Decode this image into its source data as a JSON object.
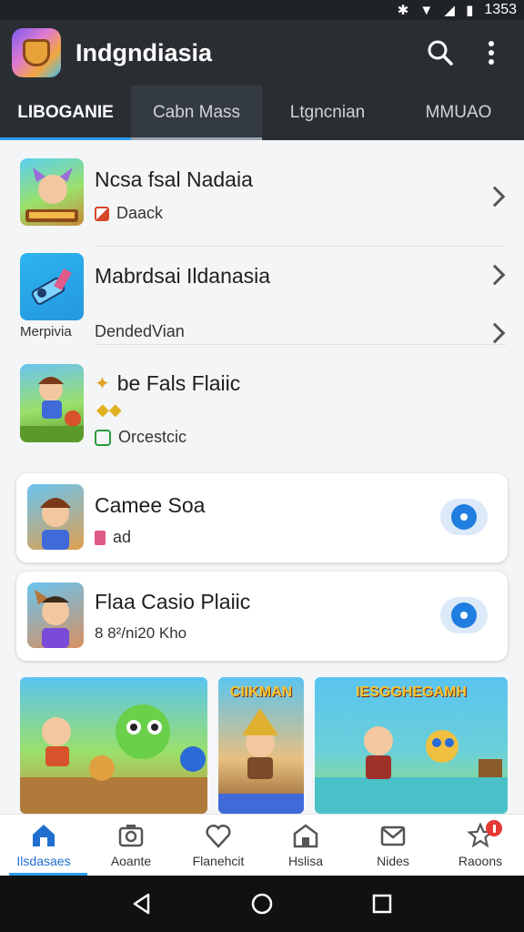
{
  "status_bar": {
    "time": "1353"
  },
  "app_bar": {
    "title": "Indgndiasia"
  },
  "tabs": [
    {
      "label": "LIBOGANIE"
    },
    {
      "label": "Cabn Mass"
    },
    {
      "label": "Ltgncnian"
    },
    {
      "label": "MMUAO"
    }
  ],
  "list": [
    {
      "title": "Ncsa fsal Nadaia",
      "sub": "Daack"
    },
    {
      "title": "Mabrdsai Ildanasia",
      "thumb_caption": "Merpivia",
      "sub": "DendedVian"
    },
    {
      "title": "be Fals Flaiic",
      "sub": "Orcestcic"
    }
  ],
  "cards": [
    {
      "title": "Camee Soa",
      "sub": "ad"
    },
    {
      "title": "Flaa Casio Plaiic",
      "sub": "8 8²/ni20 Kho"
    }
  ],
  "gallery": [
    {
      "label": ""
    },
    {
      "label": "CIIKMAN"
    },
    {
      "label": "IESGGHEGAMH"
    }
  ],
  "bottom_nav": [
    {
      "label": "Ilsdasaes",
      "icon": "home-icon"
    },
    {
      "label": "Aoante",
      "icon": "camera-icon"
    },
    {
      "label": "Flanehcit",
      "icon": "heart-icon"
    },
    {
      "label": "Hslisa",
      "icon": "store-icon"
    },
    {
      "label": "Nides",
      "icon": "mail-icon"
    },
    {
      "label": "Raoons",
      "icon": "star-icon"
    }
  ],
  "colors": {
    "appbar": "#2a2e33",
    "accent": "#2e9cf0",
    "badge": "#e53935"
  }
}
